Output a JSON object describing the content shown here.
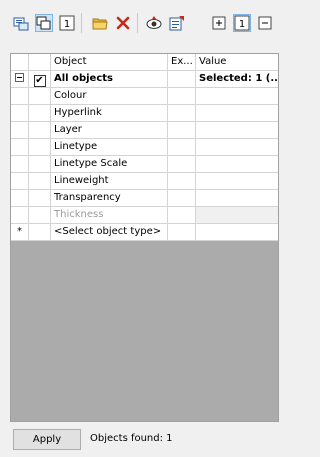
{
  "toolbar": {
    "icons": [
      "select-objects-icon",
      "pick-object-icon",
      "single-item-icon",
      "open-folder-icon",
      "delete-icon",
      "view-icon",
      "properties-icon",
      "expand-icon",
      "number-one-icon",
      "collapse-icon"
    ],
    "page_number_text": "1",
    "right_number_text": "1"
  },
  "grid": {
    "headers": {
      "object": "Object",
      "ex": "Ex...",
      "value": "Value"
    },
    "all_row": {
      "label": "All objects",
      "value": "Selected: 1 (...",
      "checked": "✔"
    },
    "items": [
      {
        "label": "Colour"
      },
      {
        "label": "Hyperlink"
      },
      {
        "label": "Layer"
      },
      {
        "label": "Linetype"
      },
      {
        "label": "Linetype Scale"
      },
      {
        "label": "Lineweight"
      },
      {
        "label": "Transparency"
      },
      {
        "label": "Thickness"
      }
    ],
    "new_row": {
      "marker": "*",
      "label": "<Select object type>"
    }
  },
  "footer": {
    "apply_label": "Apply",
    "found_text": "Objects found: 1"
  },
  "colors": {
    "close_red": "#c42b1c",
    "folder_yellow": "#e8b83a",
    "pressed_bg": "#cde6f7"
  }
}
